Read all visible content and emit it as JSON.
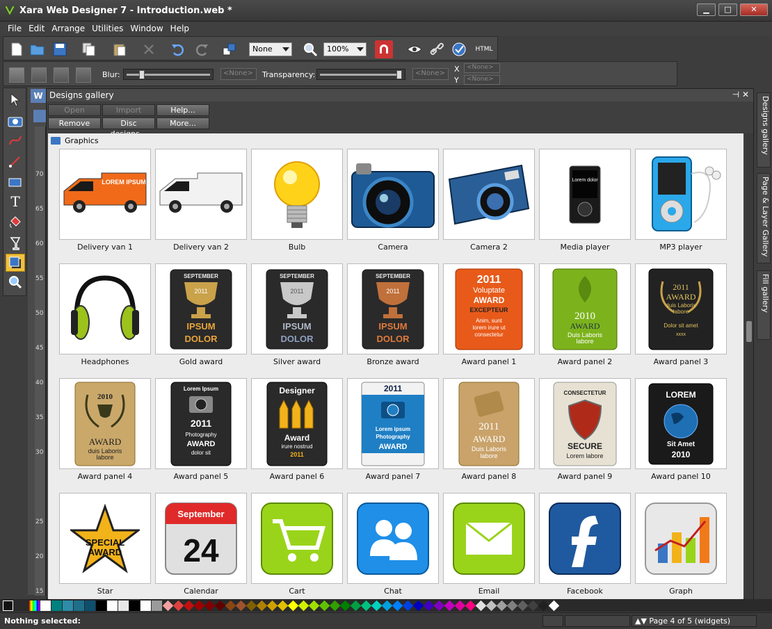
{
  "window": {
    "title": "Xara Web Designer 7 - Introduction.web *"
  },
  "menu": [
    "File",
    "Edit",
    "Arrange",
    "Utilities",
    "Window",
    "Help"
  ],
  "toolbar": {
    "font_select": "None",
    "zoom_select": "100%",
    "html_label": "HTML"
  },
  "props": {
    "blur_label": "Blur:",
    "blur_value": "<None>",
    "transparency_label": "Transparency:",
    "transparency_value": "<None>",
    "x_label": "X",
    "y_label": "Y",
    "x_value": "<None>",
    "y_value": "<None>"
  },
  "gallery": {
    "title": "Designs gallery",
    "buttons": {
      "open": "Open",
      "import": "Import",
      "help": "Help...",
      "remove": "Remove",
      "disc": "Disc designs...",
      "more": "More..."
    },
    "section": "Graphics",
    "items": [
      {
        "label": "Delivery van 1"
      },
      {
        "label": "Delivery van 2"
      },
      {
        "label": "Bulb"
      },
      {
        "label": "Camera"
      },
      {
        "label": "Camera 2"
      },
      {
        "label": "Media player"
      },
      {
        "label": "MP3 player"
      },
      {
        "label": "Headphones"
      },
      {
        "label": "Gold award"
      },
      {
        "label": "Silver award"
      },
      {
        "label": "Bronze award"
      },
      {
        "label": "Award panel 1"
      },
      {
        "label": "Award panel 2"
      },
      {
        "label": "Award panel 3"
      },
      {
        "label": "Award panel 4"
      },
      {
        "label": "Award panel 5"
      },
      {
        "label": "Award panel 6"
      },
      {
        "label": "Award panel 7"
      },
      {
        "label": "Award panel 8"
      },
      {
        "label": "Award panel 9"
      },
      {
        "label": "Award panel 10"
      },
      {
        "label": "Star"
      },
      {
        "label": "Calendar"
      },
      {
        "label": "Cart"
      },
      {
        "label": "Chat"
      },
      {
        "label": "Email"
      },
      {
        "label": "Facebook"
      },
      {
        "label": "Graph"
      }
    ],
    "thumb_text": {
      "van1": "LOREM IPSUM",
      "media": "Lorem dolor",
      "gold": {
        "month": "SEPTEMBER",
        "year": "2011",
        "l1": "IPSUM",
        "l2": "DOLOR"
      },
      "silver": {
        "month": "SEPTEMBER",
        "year": "2011",
        "l1": "IPSUM",
        "l2": "DOLOR"
      },
      "bronze": {
        "month": "SEPTEMBER",
        "year": "2011",
        "l1": "IPSUM",
        "l2": "DOLOR"
      },
      "ap1": {
        "year": "2011",
        "l1": "Voluptate",
        "l2": "AWARD",
        "l3": "EXCEPTEUR",
        "l4": "Anim, sunt",
        "l5": "lorem irure ut",
        "l6": "consectetur"
      },
      "ap2": {
        "year": "2010",
        "l1": "AWARD",
        "l2": "Duis Laboris",
        "l3": "labore"
      },
      "ap3": {
        "year": "2011",
        "l1": "AWARD",
        "l2": "duis Laboris",
        "l3": "labore",
        "l4": "Dolor sit amet",
        "l5": "xxxx"
      },
      "ap4": {
        "year": "2010",
        "l1": "AWARD",
        "l2": "duis Laboris",
        "l3": "labore"
      },
      "ap5": {
        "top": "Lorem Ipsum",
        "year": "2011",
        "l1": "Photography",
        "l2": "AWARD",
        "l3": "dolor sit"
      },
      "ap6": {
        "top": "Designer",
        "l1": "Award",
        "l2": "irure nostrud",
        "year": "2011"
      },
      "ap7": {
        "year": "2011",
        "l1": "Lorem ipsum",
        "l2": "Photography",
        "l3": "AWARD"
      },
      "ap8": {
        "year": "2011",
        "l1": "AWARD",
        "l2": "Duis Laboris",
        "l3": "labore"
      },
      "ap9": {
        "top": "CONSECTETUR",
        "l1": "SECURE",
        "l2": "Lorem labore"
      },
      "ap10": {
        "top": "LOREM",
        "l1": "Sit Amet",
        "year": "2010"
      },
      "star": {
        "l1": "SPECIAL",
        "l2": "AWARD"
      },
      "calendar": {
        "month": "September",
        "day": "24"
      }
    }
  },
  "ruler_ticks": [
    "70",
    "65",
    "60",
    "55",
    "50",
    "45",
    "40",
    "35",
    "30",
    "25",
    "20",
    "15"
  ],
  "side_tabs": [
    "Designs gallery",
    "Page & Layer Gallery",
    "Fill gallery"
  ],
  "status": {
    "selection": "Nothing selected:",
    "page": "Page 4 of 5 (widgets)"
  },
  "palette": {
    "squares": [
      "#ffffff",
      "#008080",
      "#2d8ca8",
      "#1f6f8b",
      "#0e4f6e",
      "#000000",
      "#ffffff",
      "#e8e8e8",
      "#000000",
      "#ffffff",
      "#9a9a9a"
    ],
    "diamonds": [
      "#f4a0a0",
      "#e04040",
      "#c01010",
      "#a00000",
      "#800000",
      "#600000",
      "#8b4513",
      "#a0522d",
      "#806000",
      "#b08000",
      "#d0a000",
      "#e0c000",
      "#ffff00",
      "#d0f000",
      "#a0e000",
      "#60c000",
      "#30a000",
      "#008000",
      "#00a040",
      "#00c080",
      "#00d0c0",
      "#00a0e0",
      "#0080ff",
      "#0040e0",
      "#0000c0",
      "#4000c0",
      "#8000c0",
      "#c000c0",
      "#e000a0",
      "#ff0080",
      "#e0e0e0",
      "#c0c0c0",
      "#a0a0a0",
      "#808080",
      "#606060",
      "#404040",
      "#202020",
      "#ffffff"
    ]
  }
}
